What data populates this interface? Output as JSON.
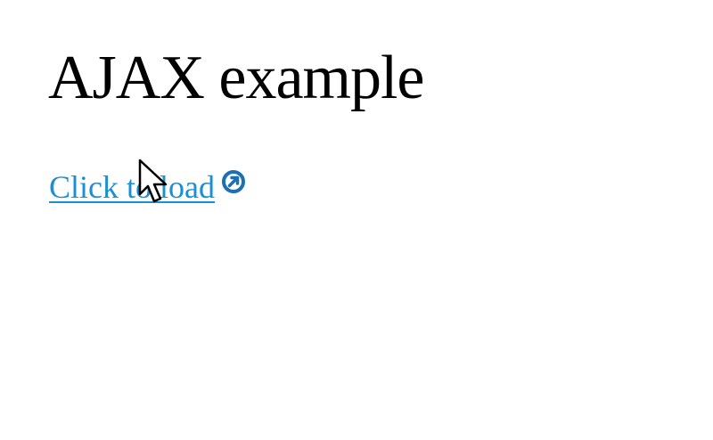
{
  "page": {
    "title": "AJAX example"
  },
  "link": {
    "label": "Click to load",
    "icon": "external-link-icon",
    "color": "#1a8fd6",
    "icon_color": "#1a6fb5"
  },
  "cursor": {
    "icon": "arrow-cursor-icon"
  }
}
